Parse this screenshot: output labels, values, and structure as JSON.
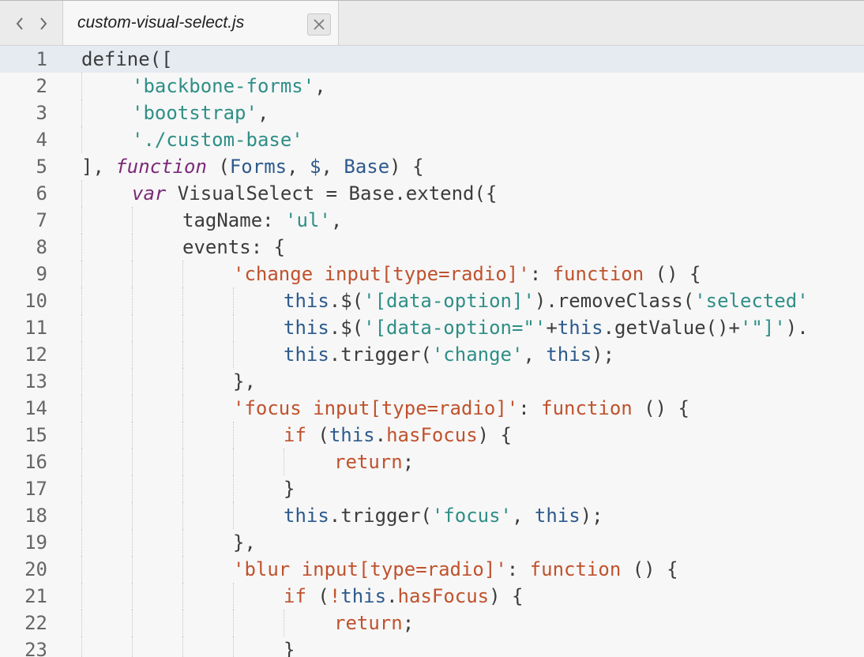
{
  "tab": {
    "filename": "custom-visual-select.js"
  },
  "colors": {
    "string": "#2e8f87",
    "key": "#c0522d",
    "keyword": "#7b2a78",
    "this": "#2d5a8c",
    "plain": "#3c3c3c",
    "current_line": "#e6ebf2"
  },
  "lines": [
    {
      "n": "1",
      "indent": 0,
      "tokens": [
        [
          "define([",
          "p"
        ]
      ]
    },
    {
      "n": "2",
      "indent": 1,
      "tokens": [
        [
          "'backbone-forms'",
          "s"
        ],
        [
          ",",
          "p"
        ]
      ]
    },
    {
      "n": "3",
      "indent": 1,
      "tokens": [
        [
          "'bootstrap'",
          "s"
        ],
        [
          ",",
          "p"
        ]
      ]
    },
    {
      "n": "4",
      "indent": 1,
      "tokens": [
        [
          "'./custom-base'",
          "s"
        ]
      ]
    },
    {
      "n": "5",
      "indent": 0,
      "tokens": [
        [
          "], ",
          "p"
        ],
        [
          "function",
          "kw"
        ],
        [
          " (",
          "p"
        ],
        [
          "Forms",
          "v"
        ],
        [
          ", ",
          "p"
        ],
        [
          "$",
          "v"
        ],
        [
          ", ",
          "p"
        ],
        [
          "Base",
          "v"
        ],
        [
          ") {",
          "p"
        ]
      ]
    },
    {
      "n": "6",
      "indent": 1,
      "tokens": [
        [
          "var",
          "kw"
        ],
        [
          " VisualSelect = Base.extend({",
          "p"
        ]
      ]
    },
    {
      "n": "7",
      "indent": 2,
      "tokens": [
        [
          "tagName: ",
          "p"
        ],
        [
          "'ul'",
          "s"
        ],
        [
          ",",
          "p"
        ]
      ]
    },
    {
      "n": "8",
      "indent": 2,
      "tokens": [
        [
          "events: {",
          "p"
        ]
      ]
    },
    {
      "n": "9",
      "indent": 3,
      "tokens": [
        [
          "'change input[type=radio]'",
          "k"
        ],
        [
          ": ",
          "p"
        ],
        [
          "function",
          "f"
        ],
        [
          " () {",
          "p"
        ]
      ]
    },
    {
      "n": "10",
      "indent": 4,
      "tokens": [
        [
          "this",
          "t"
        ],
        [
          ".$(",
          "p"
        ],
        [
          "'[data-option]'",
          "s"
        ],
        [
          ").removeClass(",
          "p"
        ],
        [
          "'selected'",
          "s"
        ]
      ]
    },
    {
      "n": "11",
      "indent": 4,
      "tokens": [
        [
          "this",
          "t"
        ],
        [
          ".$(",
          "p"
        ],
        [
          "'[data-option=\"'",
          "s"
        ],
        [
          "+",
          "p"
        ],
        [
          "this",
          "t"
        ],
        [
          ".getValue()+",
          "p"
        ],
        [
          "'\"]'",
          "s"
        ],
        [
          ").",
          "p"
        ]
      ]
    },
    {
      "n": "12",
      "indent": 4,
      "tokens": [
        [
          "this",
          "t"
        ],
        [
          ".trigger(",
          "p"
        ],
        [
          "'change'",
          "s"
        ],
        [
          ", ",
          "p"
        ],
        [
          "this",
          "t"
        ],
        [
          ");",
          "p"
        ]
      ]
    },
    {
      "n": "13",
      "indent": 3,
      "tokens": [
        [
          "},",
          "p"
        ]
      ]
    },
    {
      "n": "14",
      "indent": 3,
      "tokens": [
        [
          "'focus input[type=radio]'",
          "k"
        ],
        [
          ": ",
          "p"
        ],
        [
          "function",
          "f"
        ],
        [
          " () {",
          "p"
        ]
      ]
    },
    {
      "n": "15",
      "indent": 4,
      "tokens": [
        [
          "if",
          "f"
        ],
        [
          " (",
          "p"
        ],
        [
          "this",
          "t"
        ],
        [
          ".",
          "p"
        ],
        [
          "hasFocus",
          "f"
        ],
        [
          ") {",
          "p"
        ]
      ]
    },
    {
      "n": "16",
      "indent": 5,
      "tokens": [
        [
          "return",
          "f"
        ],
        [
          ";",
          "p"
        ]
      ]
    },
    {
      "n": "17",
      "indent": 4,
      "tokens": [
        [
          "}",
          "p"
        ]
      ]
    },
    {
      "n": "18",
      "indent": 4,
      "tokens": [
        [
          "this",
          "t"
        ],
        [
          ".trigger(",
          "p"
        ],
        [
          "'focus'",
          "s"
        ],
        [
          ", ",
          "p"
        ],
        [
          "this",
          "t"
        ],
        [
          ");",
          "p"
        ]
      ]
    },
    {
      "n": "19",
      "indent": 3,
      "tokens": [
        [
          "},",
          "p"
        ]
      ]
    },
    {
      "n": "20",
      "indent": 3,
      "tokens": [
        [
          "'blur input[type=radio]'",
          "k"
        ],
        [
          ": ",
          "p"
        ],
        [
          "function",
          "f"
        ],
        [
          " () {",
          "p"
        ]
      ]
    },
    {
      "n": "21",
      "indent": 4,
      "tokens": [
        [
          "if",
          "f"
        ],
        [
          " (",
          "p"
        ],
        [
          "!",
          "k"
        ],
        [
          "this",
          "t"
        ],
        [
          ".",
          "p"
        ],
        [
          "hasFocus",
          "f"
        ],
        [
          ") {",
          "p"
        ]
      ]
    },
    {
      "n": "22",
      "indent": 5,
      "tokens": [
        [
          "return",
          "f"
        ],
        [
          ";",
          "p"
        ]
      ]
    },
    {
      "n": "23",
      "indent": 4,
      "tokens": [
        [
          "}",
          "p"
        ]
      ]
    }
  ]
}
